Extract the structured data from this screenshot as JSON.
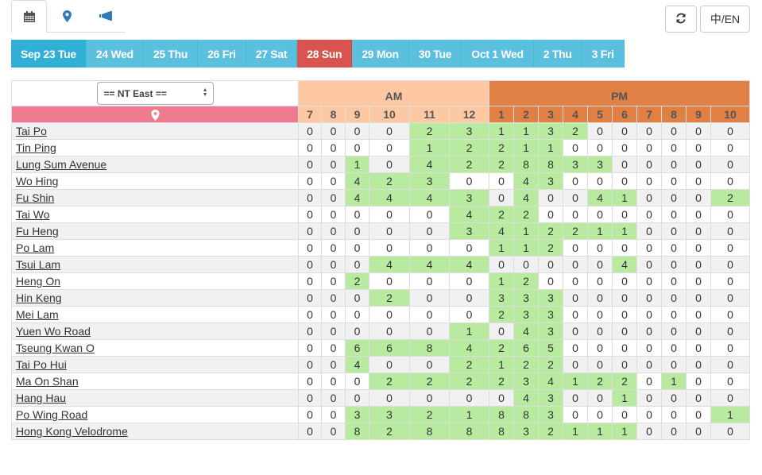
{
  "top_tabs": [
    {
      "name": "calendar",
      "icon": "calendar-icon",
      "active": true
    },
    {
      "name": "map",
      "icon": "map-marker-icon",
      "active": false
    },
    {
      "name": "announcements",
      "icon": "bullhorn-icon",
      "active": false
    }
  ],
  "toolbar": {
    "refresh_icon": "refresh-icon",
    "language_label": "中/EN"
  },
  "dates": [
    {
      "label": "Sep 23 Tue",
      "state": "active"
    },
    {
      "label": "24 Wed",
      "state": "normal"
    },
    {
      "label": "25 Thu",
      "state": "normal"
    },
    {
      "label": "26 Fri",
      "state": "normal"
    },
    {
      "label": "27 Sat",
      "state": "normal"
    },
    {
      "label": "28 Sun",
      "state": "sunday"
    },
    {
      "label": "29 Mon",
      "state": "normal"
    },
    {
      "label": "30 Tue",
      "state": "normal"
    },
    {
      "label": "Oct 1 Wed",
      "state": "normal"
    },
    {
      "label": "2 Thu",
      "state": "normal"
    },
    {
      "label": "3 Fri",
      "state": "normal"
    }
  ],
  "colors": {
    "date_button": "#5bc0de",
    "date_active": "#31b0d5",
    "date_sunday": "#d9534f",
    "am_header": "#fec8a3",
    "pm_header": "#e08045",
    "location_header": "#ef7b91",
    "positive_cell": "#b8eba0"
  },
  "table": {
    "region_select": "== NT East ==",
    "location_icon": "map-marker-icon",
    "am_label": "AM",
    "pm_label": "PM",
    "am_hours": [
      "7",
      "8",
      "9",
      "10",
      "11",
      "12"
    ],
    "pm_hours": [
      "1",
      "2",
      "3",
      "4",
      "5",
      "6",
      "7",
      "8",
      "9",
      "10"
    ],
    "rows": [
      {
        "name": "Tai Po",
        "values": [
          0,
          0,
          0,
          0,
          2,
          3,
          1,
          1,
          3,
          2,
          0,
          0,
          0,
          0,
          0,
          0
        ],
        "highlight": [
          0,
          0,
          0,
          0,
          1,
          1,
          1,
          1,
          1,
          1,
          0,
          0,
          0,
          0,
          0,
          0
        ]
      },
      {
        "name": "Tin Ping",
        "values": [
          0,
          0,
          0,
          0,
          1,
          2,
          2,
          1,
          1,
          0,
          0,
          0,
          0,
          0,
          0,
          0
        ],
        "highlight": [
          0,
          0,
          0,
          0,
          1,
          1,
          1,
          1,
          1,
          0,
          0,
          0,
          0,
          0,
          0,
          0
        ]
      },
      {
        "name": "Lung Sum Avenue",
        "values": [
          0,
          0,
          1,
          0,
          4,
          2,
          2,
          8,
          8,
          3,
          3,
          0,
          0,
          0,
          0,
          0
        ],
        "highlight": [
          0,
          0,
          1,
          0,
          1,
          1,
          1,
          1,
          1,
          1,
          1,
          0,
          0,
          0,
          0,
          0
        ]
      },
      {
        "name": "Wo Hing",
        "values": [
          0,
          0,
          4,
          2,
          3,
          0,
          0,
          4,
          3,
          0,
          0,
          0,
          0,
          0,
          0,
          0
        ],
        "highlight": [
          0,
          0,
          1,
          1,
          1,
          0,
          0,
          1,
          1,
          0,
          0,
          0,
          0,
          0,
          0,
          0
        ]
      },
      {
        "name": "Fu Shin",
        "values": [
          0,
          0,
          4,
          4,
          4,
          3,
          0,
          4,
          0,
          0,
          4,
          1,
          0,
          0,
          0,
          2
        ],
        "highlight": [
          0,
          0,
          1,
          1,
          1,
          1,
          0,
          1,
          0,
          0,
          1,
          1,
          0,
          0,
          0,
          1
        ]
      },
      {
        "name": "Tai Wo",
        "values": [
          0,
          0,
          0,
          0,
          0,
          4,
          2,
          2,
          0,
          0,
          0,
          0,
          0,
          0,
          0,
          0
        ],
        "highlight": [
          0,
          0,
          0,
          0,
          0,
          1,
          1,
          1,
          0,
          0,
          0,
          0,
          0,
          0,
          0,
          0
        ]
      },
      {
        "name": "Fu Heng",
        "values": [
          0,
          0,
          0,
          0,
          0,
          3,
          4,
          1,
          2,
          2,
          1,
          1,
          0,
          0,
          0,
          0
        ],
        "highlight": [
          0,
          0,
          0,
          0,
          0,
          1,
          1,
          1,
          1,
          1,
          1,
          1,
          0,
          0,
          0,
          0
        ]
      },
      {
        "name": "Po Lam",
        "values": [
          0,
          0,
          0,
          0,
          0,
          0,
          1,
          1,
          2,
          0,
          0,
          0,
          0,
          0,
          0,
          0
        ],
        "highlight": [
          0,
          0,
          0,
          0,
          0,
          0,
          1,
          1,
          1,
          0,
          0,
          0,
          0,
          0,
          0,
          0
        ]
      },
      {
        "name": "Tsui Lam",
        "values": [
          0,
          0,
          0,
          4,
          4,
          4,
          0,
          0,
          0,
          0,
          0,
          4,
          0,
          0,
          0,
          0
        ],
        "highlight": [
          0,
          0,
          0,
          1,
          1,
          1,
          0,
          0,
          0,
          0,
          0,
          1,
          0,
          0,
          0,
          0
        ]
      },
      {
        "name": "Heng On",
        "values": [
          0,
          0,
          2,
          0,
          0,
          0,
          1,
          2,
          0,
          0,
          0,
          0,
          0,
          0,
          0,
          0
        ],
        "highlight": [
          0,
          0,
          1,
          0,
          0,
          0,
          1,
          1,
          0,
          0,
          0,
          0,
          0,
          0,
          0,
          0
        ]
      },
      {
        "name": "Hin Keng",
        "values": [
          0,
          0,
          0,
          2,
          0,
          0,
          3,
          3,
          3,
          0,
          0,
          0,
          0,
          0,
          0,
          0
        ],
        "highlight": [
          0,
          0,
          0,
          1,
          0,
          0,
          1,
          1,
          1,
          0,
          0,
          0,
          0,
          0,
          0,
          0
        ]
      },
      {
        "name": "Mei Lam",
        "values": [
          0,
          0,
          0,
          0,
          0,
          0,
          2,
          3,
          3,
          0,
          0,
          0,
          0,
          0,
          0,
          0
        ],
        "highlight": [
          0,
          0,
          0,
          0,
          0,
          0,
          1,
          1,
          1,
          0,
          0,
          0,
          0,
          0,
          0,
          0
        ]
      },
      {
        "name": "Yuen Wo Road",
        "values": [
          0,
          0,
          0,
          0,
          0,
          1,
          0,
          4,
          3,
          0,
          0,
          0,
          0,
          0,
          0,
          0
        ],
        "highlight": [
          0,
          0,
          0,
          0,
          0,
          1,
          0,
          1,
          1,
          0,
          0,
          0,
          0,
          0,
          0,
          0
        ]
      },
      {
        "name": "Tseung Kwan O",
        "values": [
          0,
          0,
          6,
          6,
          8,
          4,
          2,
          6,
          5,
          0,
          0,
          0,
          0,
          0,
          0,
          0
        ],
        "highlight": [
          0,
          0,
          1,
          1,
          1,
          1,
          1,
          1,
          1,
          0,
          0,
          0,
          0,
          0,
          0,
          0
        ]
      },
      {
        "name": "Tai Po Hui",
        "values": [
          0,
          0,
          4,
          0,
          0,
          2,
          1,
          2,
          2,
          0,
          0,
          0,
          0,
          0,
          0,
          0
        ],
        "highlight": [
          0,
          0,
          1,
          0,
          0,
          1,
          1,
          1,
          1,
          0,
          0,
          0,
          0,
          0,
          0,
          0
        ]
      },
      {
        "name": "Ma On Shan",
        "values": [
          0,
          0,
          0,
          2,
          2,
          2,
          2,
          3,
          4,
          1,
          2,
          2,
          0,
          1,
          0,
          0
        ],
        "highlight": [
          0,
          0,
          0,
          1,
          1,
          1,
          1,
          1,
          1,
          1,
          1,
          1,
          0,
          1,
          0,
          0
        ]
      },
      {
        "name": "Hang Hau",
        "values": [
          0,
          0,
          0,
          0,
          0,
          0,
          0,
          4,
          3,
          0,
          0,
          1,
          0,
          0,
          0,
          0
        ],
        "highlight": [
          0,
          0,
          0,
          0,
          0,
          0,
          0,
          1,
          1,
          0,
          0,
          1,
          0,
          0,
          0,
          0
        ]
      },
      {
        "name": "Po Wing Road",
        "values": [
          0,
          0,
          3,
          3,
          2,
          1,
          8,
          8,
          3,
          0,
          0,
          0,
          0,
          0,
          0,
          1
        ],
        "highlight": [
          0,
          0,
          1,
          1,
          1,
          1,
          1,
          1,
          1,
          0,
          0,
          0,
          0,
          0,
          0,
          1
        ]
      },
      {
        "name": "Hong Kong Velodrome",
        "values": [
          0,
          0,
          8,
          2,
          8,
          8,
          8,
          3,
          2,
          1,
          1,
          1,
          0,
          0,
          0,
          0
        ],
        "highlight": [
          0,
          0,
          1,
          1,
          1,
          1,
          1,
          1,
          1,
          1,
          1,
          1,
          0,
          0,
          0,
          0
        ]
      }
    ]
  }
}
